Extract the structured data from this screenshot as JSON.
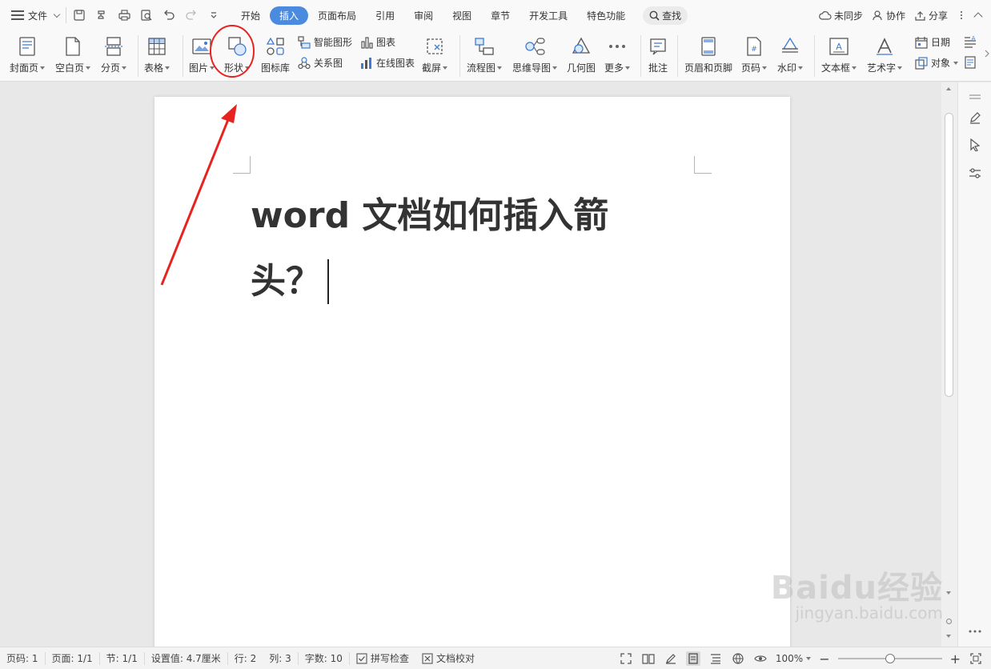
{
  "menu": {
    "file_label": "文件",
    "tabs": [
      "开始",
      "插入",
      "页面布局",
      "引用",
      "审阅",
      "视图",
      "章节",
      "开发工具",
      "特色功能"
    ],
    "active_tab_index": 1,
    "search_label": "查找",
    "sync_label": "未同步",
    "collab_label": "协作",
    "share_label": "分享"
  },
  "ribbon": {
    "cover": "封面页",
    "blank": "空白页",
    "pagebreak": "分页",
    "table": "表格",
    "picture": "图片",
    "shape": "形状",
    "iconlib": "图标库",
    "smartart": "智能图形",
    "chart": "图表",
    "relation": "关系图",
    "online_chart": "在线图表",
    "screenshot": "截屏",
    "flowchart": "流程图",
    "mindmap": "思维导图",
    "geometry": "几何图",
    "more": "更多",
    "comment": "批注",
    "header_footer": "页眉和页脚",
    "page_number": "页码",
    "watermark": "水印",
    "textbox": "文本框",
    "wordart": "艺术字",
    "date": "日期",
    "object": "对象"
  },
  "document": {
    "title_line1": "word 文档如何插入箭",
    "title_line2": "头？"
  },
  "status": {
    "page_num": "页码: 1",
    "pages": "页面: 1/1",
    "section": "节: 1/1",
    "setting": "设置值: 4.7厘米",
    "row": "行: 2",
    "col": "列: 3",
    "word_count": "字数: 10",
    "spellcheck": "拼写检查",
    "proofread": "文档校对",
    "zoom": "100%",
    "zoom_fraction": 0.5
  },
  "watermark": {
    "brand": "Baidu经验",
    "url": "jingyan.baidu.com"
  },
  "colors": {
    "active_tab": "#4a8be0",
    "annotation": "#e8231f",
    "icon_blue": "#3f7bd1"
  }
}
